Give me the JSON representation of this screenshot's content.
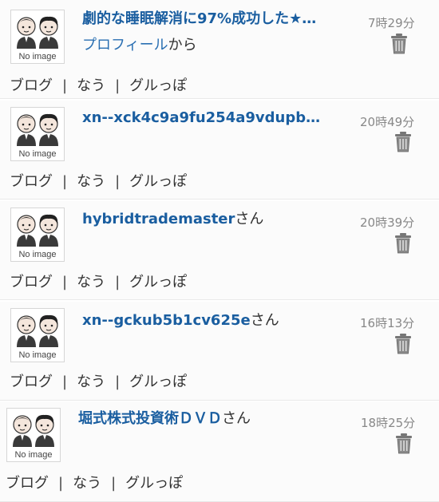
{
  "entries": [
    {
      "name": "劇的な睡眠解消に97%成功した★…",
      "suffix": "",
      "subline_link": "プロフィール",
      "subline_suffix": "から",
      "time": "7時29分",
      "avatar_text": "No image"
    },
    {
      "name": "xn--xck4c9a9fu254a9vdupb…",
      "suffix": "",
      "subline_link": "",
      "subline_suffix": "",
      "time": "20時49分",
      "avatar_text": "No image"
    },
    {
      "name": "hybridtrademaster",
      "suffix": "さん",
      "subline_link": "",
      "subline_suffix": "",
      "time": "20時39分",
      "avatar_text": "No image"
    },
    {
      "name": "xn--gckub5b1cv625e",
      "suffix": "さん",
      "subline_link": "",
      "subline_suffix": "",
      "time": "16時13分",
      "avatar_text": "No image"
    },
    {
      "name": "堀式株式投資術ＤＶＤ",
      "suffix": "さん",
      "subline_link": "",
      "subline_suffix": "",
      "time": "18時25分",
      "avatar_text": "No image"
    }
  ],
  "actions": {
    "blog": "ブログ",
    "now": "なう",
    "group": "グルっぽ",
    "separator": "|"
  },
  "icons": {
    "trash": "trash-icon",
    "avatar": "no-image-avatar-icon"
  },
  "colors": {
    "link": "#1a5ea0",
    "time": "#888888",
    "text": "#333333"
  }
}
